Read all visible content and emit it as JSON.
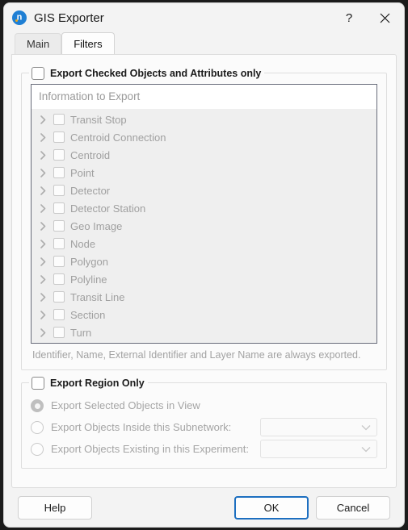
{
  "window": {
    "title": "GIS Exporter",
    "icon": "app-icon",
    "help_button": "?",
    "close_button": "✕"
  },
  "tabs": [
    {
      "label": "Main",
      "active": false
    },
    {
      "label": "Filters",
      "active": true
    }
  ],
  "filters": {
    "checked_group": {
      "legend": "Export Checked Objects and Attributes only",
      "checked": false,
      "list_header": "Information to Export",
      "items": [
        {
          "label": "Transit Stop",
          "checked": false
        },
        {
          "label": "Centroid Connection",
          "checked": false
        },
        {
          "label": "Centroid",
          "checked": false
        },
        {
          "label": "Point",
          "checked": false
        },
        {
          "label": "Detector",
          "checked": false
        },
        {
          "label": "Detector Station",
          "checked": false
        },
        {
          "label": "Geo Image",
          "checked": false
        },
        {
          "label": "Node",
          "checked": false
        },
        {
          "label": "Polygon",
          "checked": false
        },
        {
          "label": "Polyline",
          "checked": false
        },
        {
          "label": "Transit Line",
          "checked": false
        },
        {
          "label": "Section",
          "checked": false
        },
        {
          "label": "Turn",
          "checked": false
        }
      ],
      "note": "Identifier, Name, External Identifier and Layer Name are always exported."
    },
    "region_group": {
      "legend": "Export Region Only",
      "checked": false,
      "options": [
        {
          "label": "Export Selected Objects in View",
          "selected": true,
          "combo": null
        },
        {
          "label": "Export Objects Inside this Subnetwork:",
          "selected": false,
          "combo": ""
        },
        {
          "label": "Export Objects Existing in this Experiment:",
          "selected": false,
          "combo": ""
        }
      ]
    }
  },
  "footer": {
    "help": "Help",
    "ok": "OK",
    "cancel": "Cancel"
  },
  "colors": {
    "accent": "#1d6fc0",
    "window_bg": "#f3f3f3",
    "panel_bg": "#fbfbfb",
    "list_bg": "#efefef",
    "disabled_text": "#a0a0a0"
  }
}
